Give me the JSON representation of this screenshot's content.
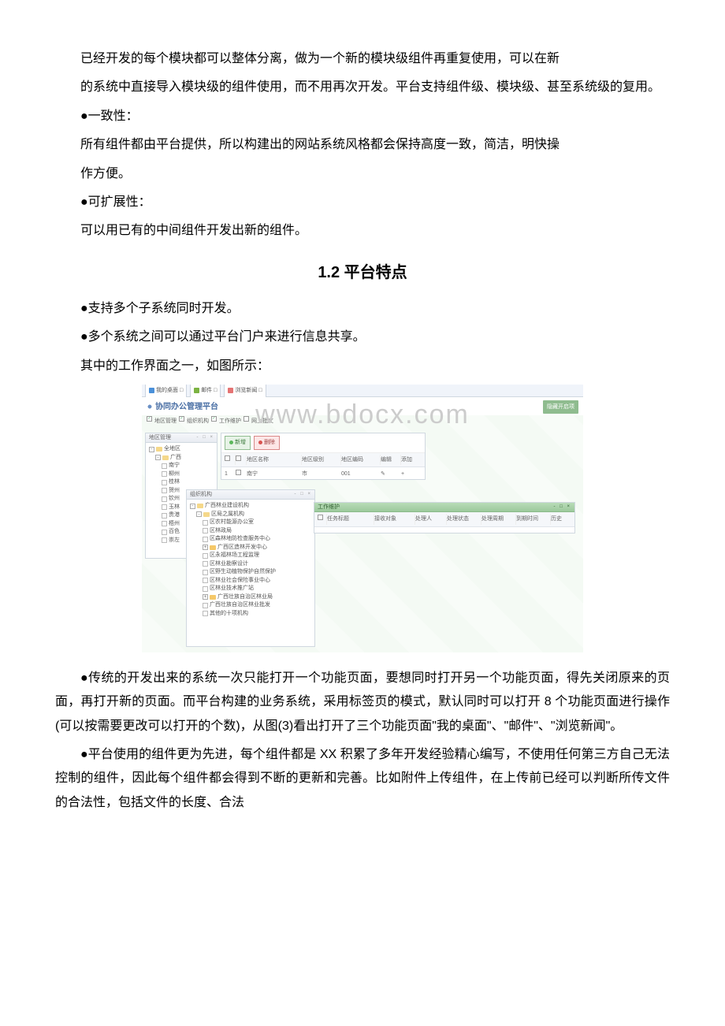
{
  "doc": {
    "p1": "已经开发的每个模块都可以整体分离，做为一个新的模块级组件再重复使用，可以在新",
    "p2": "的系统中直接导入模块级的组件使用，而不用再次开发。平台支持组件级、模块级、甚至系统级的复用。",
    "b1": "●一致性：",
    "p3": "所有组件都由平台提供，所以构建出的网站系统风格都会保持高度一致，简洁，明快操",
    "p4": "作方便。",
    "b2": "●可扩展性：",
    "p5": "可以用已有的中间组件开发出新的组件。",
    "h2": "1.2 平台特点",
    "b3": "●支持多个子系统同时开发。",
    "b4": "●多个系统之间可以通过平台门户来进行信息共享。",
    "p6": "其中的工作界面之一，如图所示：",
    "p7": "●传统的开发出来的系统一次只能打开一个功能页面，要想同时打开另一个功能页面，得先关闭原来的页面，再打开新的页面。而平台构建的业务系统，采用标签页的模式，默认同时可以打开 8 个功能页面进行操作(可以按需要更改可以打开的个数)，从图(3)看出打开了三个功能页面\"我的桌面\"、\"邮件\"、\"浏览新闻\"。",
    "p8": "●平台使用的组件更为先进，每个组件都是 XX 积累了多年开发经验精心编写，不使用任何第三方自己无法控制的组件，因此每个组件都会得到不断的更新和完善。比如附件上传组件，在上传前已经可以判断所传文件的合法性，包括文件的长度、合法"
  },
  "app": {
    "watermark": "www.bdocx.com",
    "tabs": {
      "t1": "我的桌面 □",
      "t2": "邮件 □",
      "t3": "浏览新闻 □"
    },
    "title": "协同办公管理平台",
    "topbtn": "隐藏开启项",
    "checks": {
      "c1": "地区管理",
      "c2": "组织机构",
      "c3": "工作维护",
      "c4": "网上批文"
    },
    "regionPanel": {
      "title": "地区管理",
      "root": "全地区",
      "cat": "广西",
      "items": [
        "南宁",
        "柳州",
        "桂林",
        "贺州",
        "钦州",
        "玉林",
        "贵港",
        "梧州",
        "百色",
        "崇左"
      ]
    },
    "orgPanel": {
      "title": "组织机构",
      "root": "广西林业建设机构",
      "cat": "区局之属机构",
      "items": [
        "区农村能源办公室",
        "区林政局",
        "区森林地防检查服务中心",
        "广西区造林开发中心",
        "区永福林场工程监理",
        "区林业勘察设计",
        "区野生动植物保护自然保护",
        "区林业社会保险事业中心",
        "区林业技术推广站",
        "广西壮族自治区林业局",
        "广西壮族自治区林业批发",
        "其他的十项机构"
      ],
      "exp1": "广西区造林开发中心",
      "exp2": "广西壮族自治区林业局"
    },
    "list1": {
      "btnNew": "新增",
      "btnDel": "删除",
      "h1": "地区名称",
      "h2": "地区级别",
      "h3": "地区编码",
      "h4": "编辑",
      "h5": "添加",
      "r1c1": "1",
      "r1c2": "南宁",
      "r1c3": "市",
      "r1c4": "001"
    },
    "list2": {
      "title": "工作维护",
      "h1": "任务标题",
      "h2": "接收对象",
      "h3": "处理人",
      "h4": "处理状态",
      "h5": "处理周期",
      "h6": "到期时间",
      "h7": "历史"
    },
    "icons": {
      "desktop": "desktop-icon",
      "mail": "mail-icon",
      "news": "news-icon"
    }
  }
}
